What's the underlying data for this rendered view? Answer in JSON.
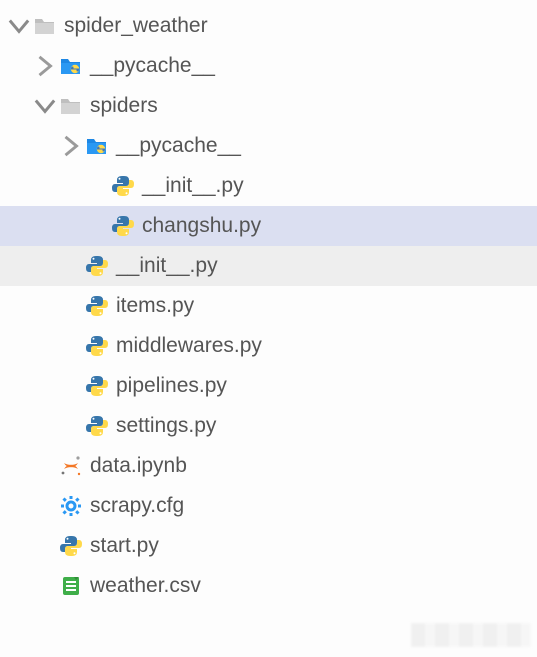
{
  "tree": {
    "nodes": [
      {
        "depth": 0,
        "arrow": "down",
        "icon": "folder",
        "label": "spider_weather",
        "state": ""
      },
      {
        "depth": 1,
        "arrow": "right",
        "icon": "pyfolder",
        "label": "__pycache__",
        "state": ""
      },
      {
        "depth": 1,
        "arrow": "down",
        "icon": "folder",
        "label": "spiders",
        "state": ""
      },
      {
        "depth": 2,
        "arrow": "right",
        "icon": "pyfolder",
        "label": "__pycache__",
        "state": ""
      },
      {
        "depth": 3,
        "arrow": "",
        "icon": "python",
        "label": "__init__.py",
        "state": ""
      },
      {
        "depth": 3,
        "arrow": "",
        "icon": "python",
        "label": "changshu.py",
        "state": "selected"
      },
      {
        "depth": 2,
        "arrow": "",
        "icon": "python",
        "label": "__init__.py",
        "state": "hover"
      },
      {
        "depth": 2,
        "arrow": "",
        "icon": "python",
        "label": "items.py",
        "state": ""
      },
      {
        "depth": 2,
        "arrow": "",
        "icon": "python",
        "label": "middlewares.py",
        "state": ""
      },
      {
        "depth": 2,
        "arrow": "",
        "icon": "python",
        "label": "pipelines.py",
        "state": ""
      },
      {
        "depth": 2,
        "arrow": "",
        "icon": "python",
        "label": "settings.py",
        "state": ""
      },
      {
        "depth": 1,
        "arrow": "",
        "icon": "jupyter",
        "label": "data.ipynb",
        "state": ""
      },
      {
        "depth": 1,
        "arrow": "",
        "icon": "gear",
        "label": "scrapy.cfg",
        "state": ""
      },
      {
        "depth": 1,
        "arrow": "",
        "icon": "python",
        "label": "start.py",
        "state": ""
      },
      {
        "depth": 1,
        "arrow": "",
        "icon": "csv",
        "label": "weather.csv",
        "state": ""
      }
    ]
  }
}
